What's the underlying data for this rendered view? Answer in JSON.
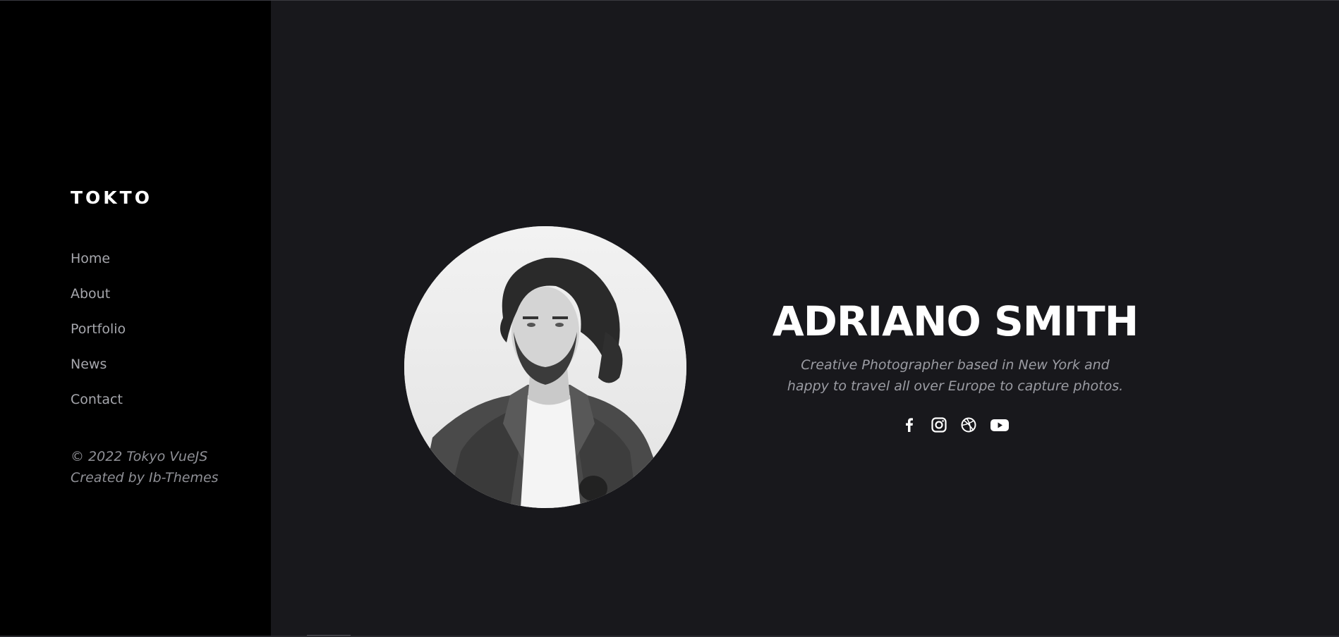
{
  "sidebar": {
    "logo": "TOKTO",
    "nav": [
      {
        "label": "Home"
      },
      {
        "label": "About"
      },
      {
        "label": "Portfolio"
      },
      {
        "label": "News"
      },
      {
        "label": "Contact"
      }
    ],
    "copyright_line1": "© 2022 Tokyo VueJS",
    "copyright_line2": "Created by Ib-Themes"
  },
  "hero": {
    "name": "ADRIANO SMITH",
    "job": "Creative Photographer based in New York and happy to travel all over Europe to capture photos.",
    "social": [
      "facebook-icon",
      "instagram-icon",
      "dribbble-icon",
      "youtube-icon"
    ]
  },
  "colors": {
    "sidebar_bg": "#000000",
    "main_bg": "#18181c",
    "nav_text": "#a6a7ad",
    "heading": "#ffffff"
  }
}
